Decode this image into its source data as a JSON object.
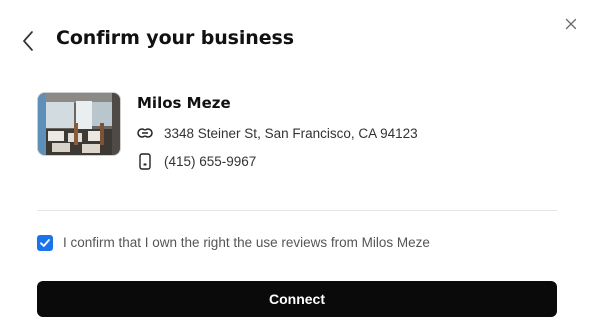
{
  "header": {
    "title": "Confirm your business",
    "back_icon": "chevron-left-icon",
    "close_icon": "close-icon"
  },
  "business": {
    "photo_icon": "restaurant-photo",
    "name": "Milos Meze",
    "address_icon": "link-icon",
    "address": "3348 Steiner St, San Francisco, CA 94123",
    "phone_icon": "phone-icon",
    "phone": "(415) 655-9967"
  },
  "confirmation": {
    "checked": true,
    "label": "I confirm that I own the right the use reviews from Milos Meze"
  },
  "actions": {
    "connect_label": "Connect"
  },
  "colors": {
    "checkbox": "#1a73e8",
    "button": "#0a0a0a"
  }
}
